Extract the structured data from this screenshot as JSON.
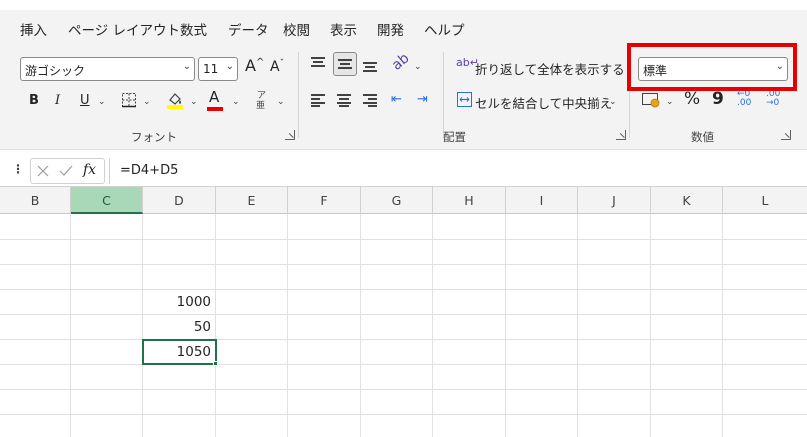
{
  "menu": {
    "tabs": [
      {
        "label": "挿入"
      },
      {
        "label": "ページ レイアウト"
      },
      {
        "label": "数式"
      },
      {
        "label": "データ"
      },
      {
        "label": "校閲"
      },
      {
        "label": "表示"
      },
      {
        "label": "開発"
      },
      {
        "label": "ヘルプ"
      }
    ]
  },
  "ribbon": {
    "font": {
      "group_label": "フォント",
      "font_name": "游ゴシック",
      "font_size": "11",
      "grow_label": "A",
      "shrink_label": "A",
      "bold_label": "B",
      "italic_label": "I",
      "underline_label": "U",
      "font_color_label": "A",
      "phonetic_label": "亜",
      "fill_color": "#ffff00",
      "font_color": "#e60000"
    },
    "alignment": {
      "group_label": "配置",
      "wrap_text_label": "折り返して全体を表示する",
      "merge_center_label": "セルを結合して中央揃え"
    },
    "number": {
      "group_label": "数値",
      "number_format": "標準",
      "percent_label": "%",
      "comma_label": "9",
      "increase_decimal_label": "←0 .00",
      "decrease_decimal_label": ".00 →0"
    }
  },
  "formula_bar": {
    "fx_label": "fx",
    "formula": "=D4+D5"
  },
  "grid": {
    "columns": [
      "B",
      "C",
      "D",
      "E",
      "F",
      "G",
      "H",
      "I",
      "J",
      "K",
      "L"
    ],
    "active_column": "C",
    "cells": [
      {
        "ref": "D4",
        "value": "1000"
      },
      {
        "ref": "D5",
        "value": "50"
      },
      {
        "ref": "D6",
        "value": "1050"
      }
    ]
  },
  "colors": {
    "accent_green": "#217346",
    "highlight_red": "#e60000"
  }
}
